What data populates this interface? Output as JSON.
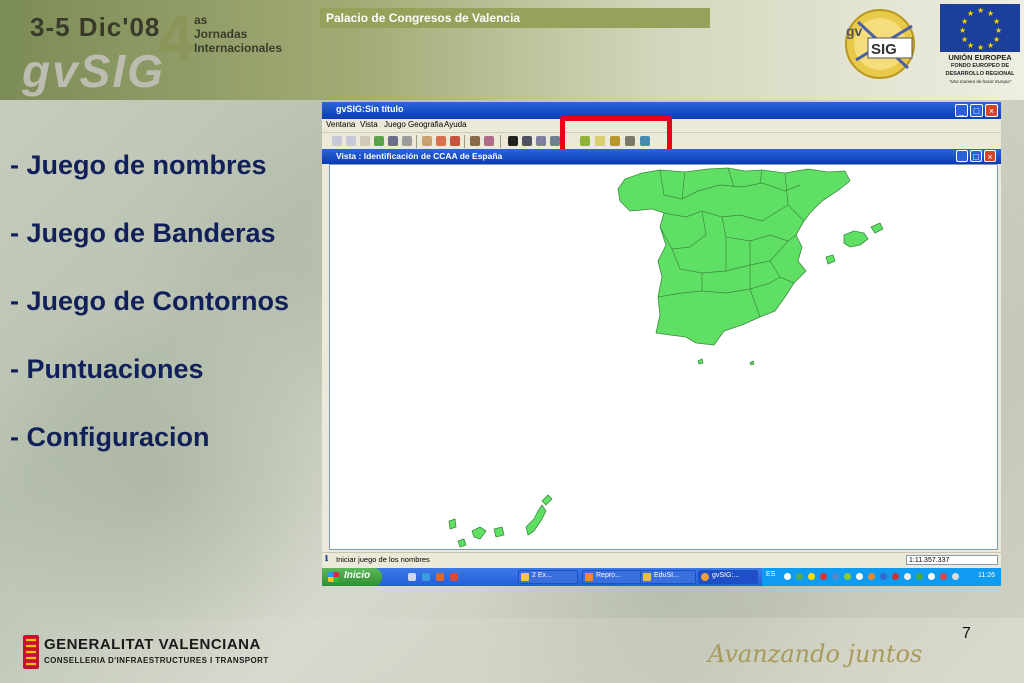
{
  "banner": {
    "date": "3-5 Dic'08",
    "edition": "4",
    "jornadas": "as\nJornadas\nInternacionales",
    "brand": "gvSIG",
    "venue": "Palacio de Congresos de Valencia",
    "logo_text": "gvSIG",
    "logo_gv": "gv",
    "logo_sig": "SIG",
    "eu_title": "UNIÓN EUROPEA",
    "eu_fund": "FONDO EUROPEO DE DESARROLLO REGIONAL",
    "eu_motto": "\"Una manera de hacer Europa\""
  },
  "bullets": [
    "- Juego de nombres",
    "- Juego de Banderas",
    "- Juego de Contornos",
    "- Puntuaciones",
    "- Configuracion"
  ],
  "app": {
    "title": "gvSIG:Sin título",
    "menu": [
      "Ventana",
      "Vista",
      "Juego Geografia",
      "Ayuda"
    ],
    "view_title": "Vista : Identificación de CCAA de España",
    "status_message": "Iniciar juego de los nombres",
    "scale": "1:11.357.337",
    "colors": {
      "map_fill": "#5fe065",
      "map_stroke": "#3a8a3e",
      "highlight": "#e8001a",
      "title_bar": "#0a3cb6"
    }
  },
  "taskbar": {
    "start_label": "Inicio",
    "tasks": [
      "2 Ex...",
      "Repro...",
      "EduSI...",
      "gvSIG:..."
    ],
    "language": "ES",
    "clock": "11:26"
  },
  "footer": {
    "institution": "GENERALITAT VALENCIANA",
    "department": "CONSELLERIA D'INFRAESTRUCTURES I TRANSPORT",
    "slogan": "Avanzando juntos",
    "page_number": "7"
  }
}
